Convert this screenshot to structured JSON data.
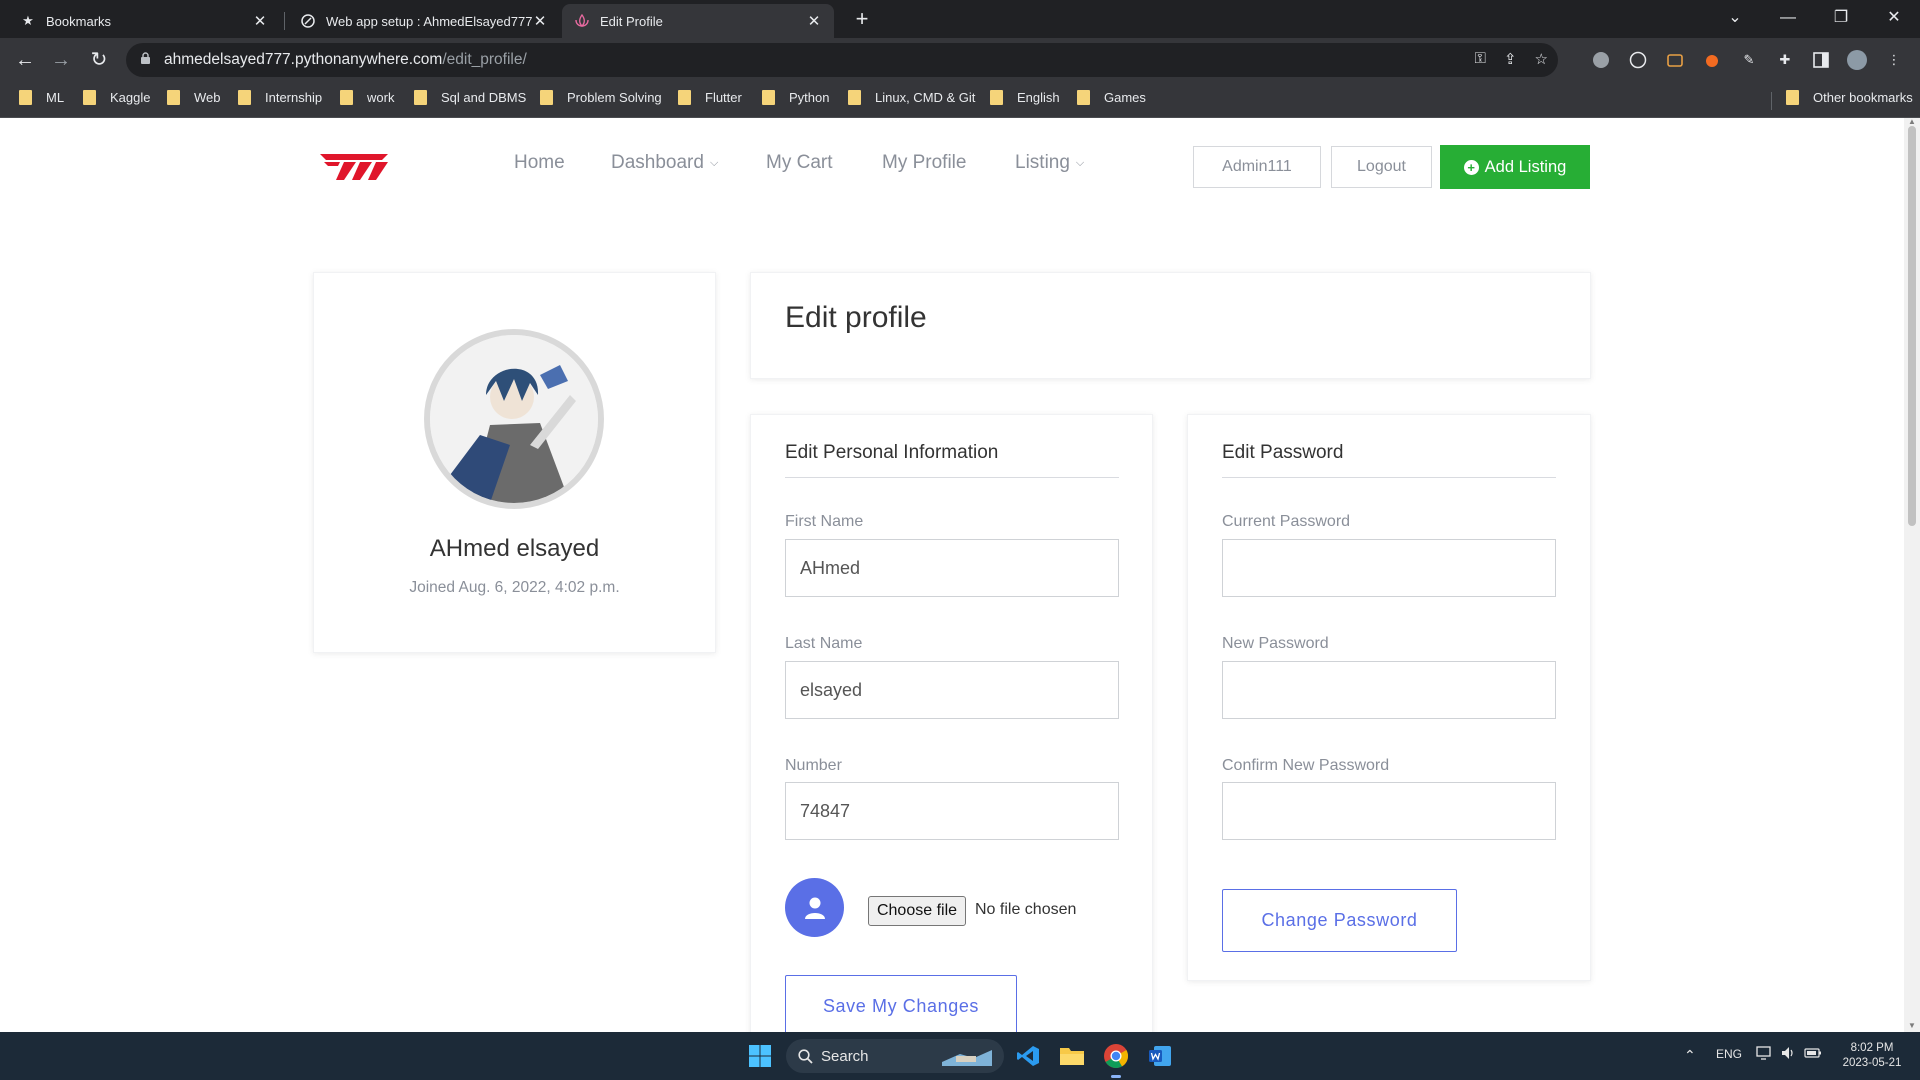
{
  "browser": {
    "tabs": [
      {
        "title": "Bookmarks",
        "icon": "star-icon",
        "active": false
      },
      {
        "title": "Web app setup : AhmedElsayed777",
        "icon": "pythonanywhere-icon",
        "active": false
      },
      {
        "title": "Edit Profile",
        "icon": "lotus-icon",
        "active": true
      }
    ],
    "url_host": "ahmedelsayed777.pythonanywhere.com",
    "url_path": "/edit_profile/",
    "bookmarks": [
      "ML",
      "Kaggle",
      "Web",
      "Internship",
      "work",
      "Sql and DBMS",
      "Problem Solving",
      "Flutter",
      "Python",
      "Linux, CMD & Git",
      "English",
      "Games"
    ],
    "other_bookmarks": "Other bookmarks"
  },
  "site_nav": {
    "links": [
      "Home",
      "Dashboard",
      "My Cart",
      "My Profile",
      "Listing"
    ],
    "user_button": "Admin111",
    "logout_button": "Logout",
    "add_listing_button": "Add Listing"
  },
  "profile_card": {
    "name": "AHmed elsayed",
    "joined": "Joined Aug. 6, 2022, 4:02 p.m."
  },
  "edit_header": {
    "title": "Edit profile"
  },
  "personal_info": {
    "title": "Edit Personal Information",
    "first_name_label": "First Name",
    "first_name_value": "AHmed",
    "last_name_label": "Last Name",
    "last_name_value": "elsayed",
    "number_label": "Number",
    "number_value": "74847",
    "choose_file_label": "Choose file",
    "no_file_text": "No file chosen",
    "save_button": "Save My Changes"
  },
  "password": {
    "title": "Edit Password",
    "current_label": "Current Password",
    "new_label": "New Password",
    "confirm_label": "Confirm New Password",
    "change_button": "Change Password"
  },
  "taskbar": {
    "search_label": "Search",
    "language": "ENG",
    "time": "8:02 PM",
    "date": "2023-05-21"
  },
  "colors": {
    "brand_red": "#e0162b",
    "accent_blue": "#5a6fe6",
    "success_green": "#27ae35"
  }
}
